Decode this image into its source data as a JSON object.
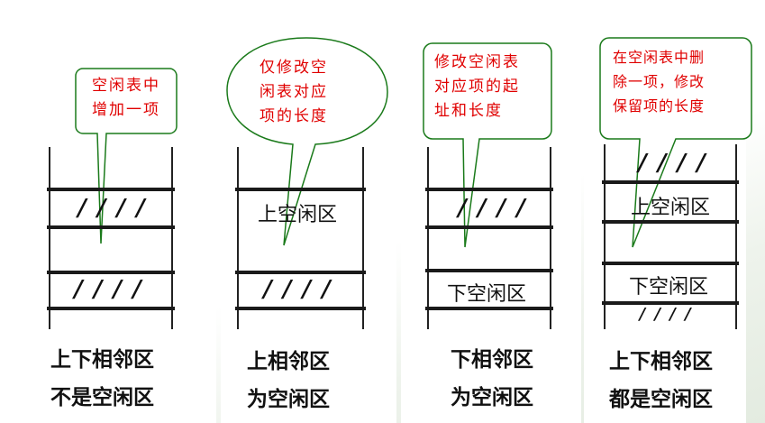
{
  "cases": [
    {
      "callout": {
        "lines": [
          "空闲表中",
          "增加一项"
        ]
      },
      "regions": [
        {
          "text": "////"
        },
        {
          "text": ""
        },
        {
          "text": "////"
        }
      ],
      "caption": [
        "上下相邻区",
        "不是空闲区"
      ]
    },
    {
      "callout": {
        "lines": [
          "仅修改空",
          "闲表对应",
          "项的长度"
        ]
      },
      "regions": [
        {
          "text": "上空闲区"
        },
        {
          "text": ""
        },
        {
          "text": "////"
        }
      ],
      "caption": [
        "上相邻区",
        "为空闲区"
      ]
    },
    {
      "callout": {
        "lines": [
          "修改空闲表",
          "对应项的起",
          "址和长度"
        ]
      },
      "regions": [
        {
          "text": "////"
        },
        {
          "text": ""
        },
        {
          "text": "下空闲区"
        }
      ],
      "caption": [
        "下相邻区",
        "为空闲区"
      ]
    },
    {
      "callout": {
        "lines": [
          "在空闲表中删",
          "除一项，修改",
          "保留项的长度"
        ]
      },
      "regions": [
        {
          "text": "////"
        },
        {
          "text": "上空闲区"
        },
        {
          "text": ""
        },
        {
          "text": "下空闲区"
        },
        {
          "text": "////"
        }
      ],
      "caption": [
        "上下相邻区",
        "都是空闲区"
      ]
    }
  ],
  "colors": {
    "callout_border": "#1a7a1a",
    "callout_text": "#e00000",
    "ink": "#111111"
  }
}
